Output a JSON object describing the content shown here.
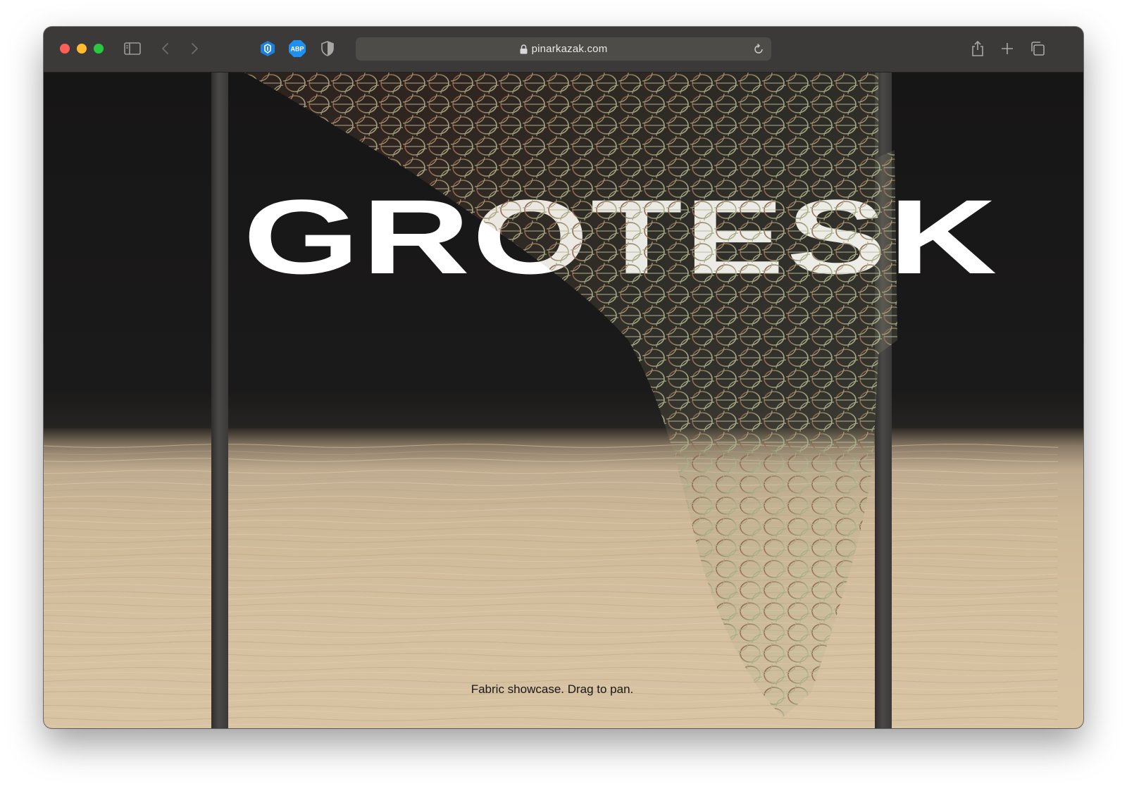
{
  "browser": {
    "url": "pinarkazak.com",
    "extensions": [
      "shield-extension-icon",
      "adblock-extension-icon",
      "privacy-shield-icon"
    ],
    "adblock_badge": "ABP"
  },
  "page": {
    "headline": "GROTESK",
    "caption": "Fabric showcase. Drag to pan."
  },
  "colors": {
    "toolbar": "#3b3a38",
    "wall": "#1b1a1a",
    "floor": "#d4bf9f",
    "headline": "#ffffff",
    "fabric_warm": "#9b6a4e",
    "fabric_cool": "#a9ab88"
  }
}
